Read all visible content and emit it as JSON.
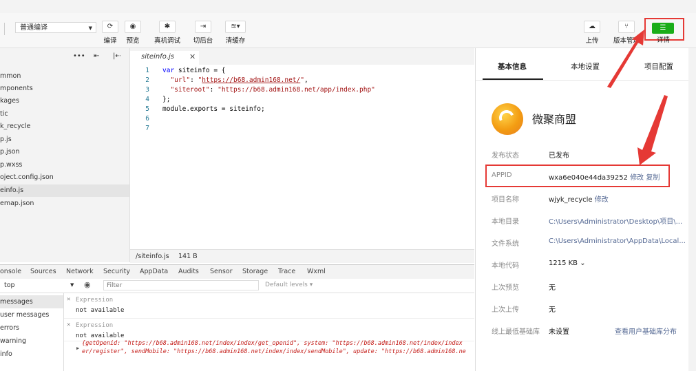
{
  "toolbar": {
    "mode_select": "普通编译",
    "buttons": [
      {
        "label": "编译",
        "icon": "refresh-icon"
      },
      {
        "label": "预览",
        "icon": "eye-icon"
      },
      {
        "label": "真机调试",
        "icon": "bug-icon"
      },
      {
        "label": "切后台",
        "icon": "switch-icon"
      },
      {
        "label": "清缓存",
        "icon": "layers-icon"
      }
    ],
    "right_buttons": [
      {
        "label": "上传",
        "icon": "cloud-upload-icon"
      },
      {
        "label": "版本管理",
        "icon": "branch-icon"
      },
      {
        "label": "详情",
        "icon": "menu-icon"
      }
    ]
  },
  "file_tree": {
    "items": [
      "mmon",
      "mponents",
      "kages",
      "tic",
      "k_recycle",
      "p.js",
      "p.json",
      "p.wxss",
      "oject.config.json",
      "einfo.js",
      "emap.json"
    ],
    "active_index": 9
  },
  "editor": {
    "tab_name": "siteinfo.js",
    "line_numbers": [
      "1",
      "2",
      "3",
      "4",
      "5",
      "6",
      "7"
    ],
    "code": {
      "l1_kw": "var",
      "l1_rest": " siteinfo = {",
      "l2_key": "\"url\"",
      "l2_colon": ": ",
      "l2_q1": "\"",
      "l2_url": "https://b68.admin168.net/",
      "l2_q2": "\"",
      "l2_end": ",",
      "l3_key": "\"siteroot\"",
      "l3_colon": ": ",
      "l3_val": "\"https://b68.admin168.net/app/index.php\"",
      "l4": "};",
      "l5": "module.exports = siteinfo;"
    },
    "status_path": "/siteinfo.js",
    "status_size": "141 B"
  },
  "devtools": {
    "tabs": [
      "onsole",
      "Sources",
      "Network",
      "Security",
      "AppData",
      "Audits",
      "Sensor",
      "Storage",
      "Trace",
      "Wxml"
    ],
    "context": "top",
    "filter_placeholder": "Filter",
    "levels": "Default levels ▾",
    "side_items": [
      " messages",
      " user messages",
      "errors",
      "warning",
      " info"
    ],
    "logs": [
      {
        "label": "Expression",
        "value": "not available"
      },
      {
        "label": "Expression",
        "value": "not available"
      }
    ],
    "error_line1": "{getOpenid: \"https://b68.admin168.net/index/index/get_openid\", system: \"https://b68.admin168.net/index/index",
    "error_line2": "er/register\", sendMobile: \"https://b68.admin168.net/index/index/sendMobile\", update: \"https://b68.admin168.ne"
  },
  "right_panel": {
    "tabs": [
      "基本信息",
      "本地设置",
      "项目配置"
    ],
    "app_name": "微聚商盟",
    "rows": [
      {
        "label": "发布状态",
        "value": "已发布"
      },
      {
        "label": "APPID",
        "value": "wxa6e040e44da39252",
        "action1": "修改",
        "action2": "复制"
      },
      {
        "label": "项目名称",
        "value": "wjyk_recycle",
        "action1": "修改"
      },
      {
        "label": "本地目录",
        "value": "C:\\Users\\Administrator\\Desktop\\项目\\..."
      },
      {
        "label": "文件系统",
        "value": "C:\\Users\\Administrator\\AppData\\Local..."
      },
      {
        "label": "本地代码",
        "value": "1215 KB ⌄"
      },
      {
        "label": "上次预览",
        "value": "无"
      },
      {
        "label": "上次上传",
        "value": "无"
      },
      {
        "label": "线上最低基础库",
        "value": "未设置",
        "action1": "查看用户基础库分布"
      }
    ]
  },
  "colors": {
    "accent_green": "#1aad19",
    "highlight_red": "#e53935",
    "link_blue": "#576b95"
  }
}
